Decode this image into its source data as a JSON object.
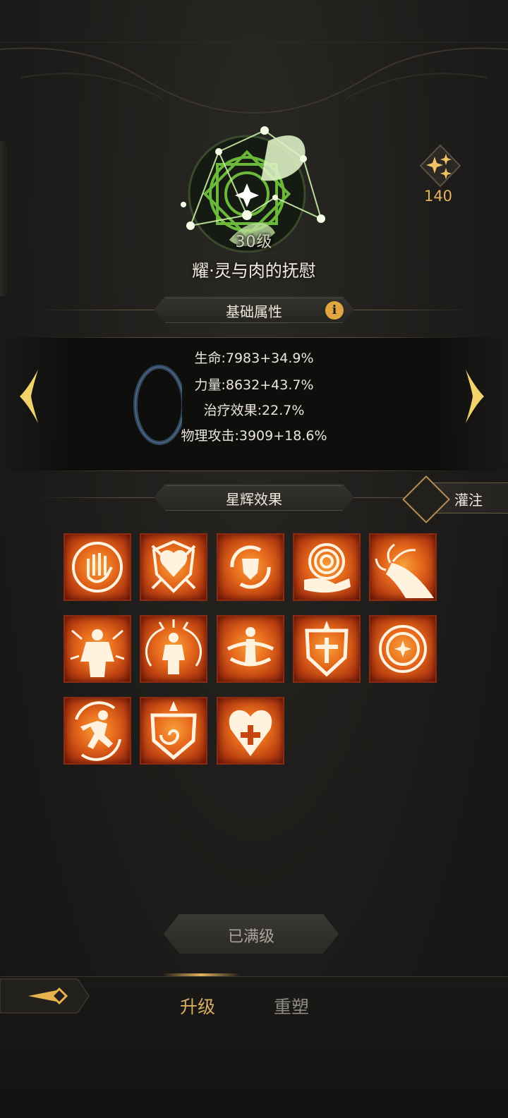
{
  "skill": {
    "level": "30级",
    "name": "耀·灵与肉的抚慰"
  },
  "currency": {
    "icon": "stardust-icon",
    "value": "140"
  },
  "base_stats": {
    "title": "基础属性",
    "lines": [
      "生命:7983+34.9%",
      "力量:8632+43.7%",
      "治疗效果:22.7%",
      "物理攻击:3909+18.6%"
    ]
  },
  "starlight": {
    "title": "星辉效果",
    "infuse_label": "灌注",
    "effects": [
      "palm-icon",
      "shield-heart-icon",
      "swirl-shield-icon",
      "vortex-hand-icon",
      "tendril-hand-icon",
      "burst-figure-icon",
      "wing-figure-icon",
      "spinning-figure-icon",
      "crossed-shield-icon",
      "sun-ring-icon",
      "running-figure-icon",
      "spiral-shield-icon",
      "cross-heart-icon"
    ]
  },
  "maxed_label": "已满级",
  "tabs": {
    "upgrade": "升级",
    "reforge": "重塑"
  },
  "colors": {
    "accent_gold": "#e2b45e",
    "emblem_green": "#8fd052",
    "effect_orange": "#e76a1c"
  }
}
